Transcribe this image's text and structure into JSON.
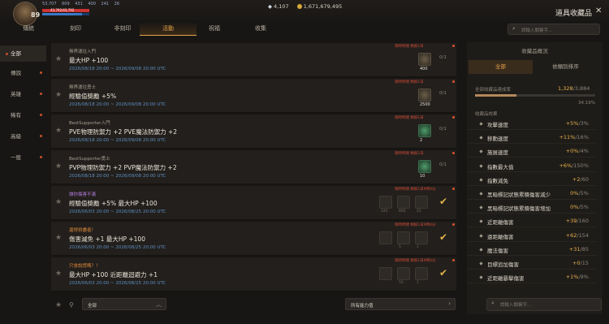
{
  "header": {
    "level": "89",
    "stats": [
      "53,707",
      "609",
      "431",
      "400",
      "241",
      "26"
    ],
    "hp_text": "43,792/43,792",
    "hp_fraction": 1.0,
    "mp_fraction": 0.85,
    "gems": "4,107",
    "gold": "1,671,679,495",
    "title": "道具收藏品",
    "close_icon": "close-icon"
  },
  "tabs": [
    {
      "label": "傳統"
    },
    {
      "label": "刻印"
    },
    {
      "label": "非刻印"
    },
    {
      "label": "活動",
      "active": true
    },
    {
      "label": "祝福"
    },
    {
      "label": "收集"
    }
  ],
  "search": {
    "placeholder": "請輸入關鍵字..."
  },
  "sidebar": [
    {
      "label": "全部",
      "active": true
    },
    {
      "label": "傳說"
    },
    {
      "label": "英雄"
    },
    {
      "label": "稀有"
    },
    {
      "label": "高級"
    },
    {
      "label": "一般"
    }
  ],
  "list": [
    {
      "category": "無界運往入門",
      "cat_color": "normal",
      "name": "最大HP +100",
      "date": "2026/08/18 20:00 ~ 2026/09/08 20:00 UTC",
      "limit": "限時時間 剩餘1日",
      "items": [
        {
          "count": "400",
          "type": "gold"
        }
      ],
      "progress": "0/1"
    },
    {
      "category": "無界運往勇士",
      "cat_color": "normal",
      "name": "經驗值獎勵 +5%",
      "date": "2026/08/18 20:00 ~ 2026/09/08 20:00 UTC",
      "limit": "限時時間 剩餘1日",
      "items": [
        {
          "count": "2500",
          "type": "gold"
        }
      ],
      "progress": "0/1"
    },
    {
      "category": "BestSupporter入門",
      "cat_color": "normal",
      "name": "PVE物理防禦力 +2 PVE魔法防禦力 +2",
      "date": "2026/08/18 20:00 ~ 2026/09/08 20:00 UTC",
      "limit": "限時時間 剩餘1日",
      "items": [
        {
          "count": "2",
          "type": "green"
        }
      ],
      "progress": "0/1"
    },
    {
      "category": "BestSupporter勇士",
      "cat_color": "normal",
      "name": "PVP物理防禦力 +2 PVP魔法防禦力 +2",
      "date": "2026/08/18 20:00 ~ 2026/09/08 20:00 UTC",
      "limit": "限時時間 剩餘1日",
      "items": [
        {
          "count": "10",
          "type": "green"
        }
      ],
      "progress": "0/1"
    },
    {
      "category": "讓你傷害不滿",
      "cat_color": "purple",
      "name": "經驗值獎勵 +5% 最大HP +100",
      "date": "2026/06/03 20:00 ~ 2026/08/25 20:00 UTC",
      "limit": "限時時間 剩餘1日9時0分",
      "items": [
        {
          "count": "340",
          "type": "dim"
        },
        {
          "count": "800",
          "type": "dim"
        },
        {
          "count": "41",
          "type": "dim"
        }
      ],
      "done": true
    },
    {
      "category": "還得拚盡者！",
      "cat_color": "orange",
      "name": "傷害減免 +1 最大HP +100",
      "date": "2026/06/03 20:00 ~ 2026/08/25 20:00 UTC",
      "limit": "限時時間 剩餘1日9時0分",
      "items": [
        {
          "count": "",
          "type": "dim"
        },
        {
          "count": "5",
          "type": "dim"
        },
        {
          "count": "1",
          "type": "dim"
        }
      ],
      "done": true
    },
    {
      "category": "只會說謊嗎？！",
      "cat_color": "orange",
      "name": "最大HP +100 近距離迴避力 +1",
      "date": "2026/06/03 20:00 ~ 2026/08/25 20:00 UTC",
      "limit": "限時時間 剩餘1日9時0分",
      "items": [
        {
          "count": "",
          "type": "dim"
        },
        {
          "count": "50",
          "type": "dim"
        },
        {
          "count": "1",
          "type": "dim"
        }
      ],
      "done": true
    },
    {
      "category": "殺戮執著",
      "cat_color": "orange",
      "name": "",
      "date": "",
      "limit": "",
      "items": [],
      "partial": true
    }
  ],
  "bottom": {
    "filter_value": "全部",
    "stat_filter_value": "所有能力值"
  },
  "right_panel": {
    "header": "收藏品概況",
    "tabs": [
      {
        "label": "全部",
        "active": true
      },
      {
        "label": "依類別排序"
      }
    ],
    "completion_label": "全部收藏品達成率",
    "completion_done": "1,328",
    "completion_total": "3,884",
    "completion_fraction": 0.3419,
    "completion_pct": "34.19%",
    "effects_label": "收藏品效果",
    "stats": [
      {
        "name": "攻擊速度",
        "value": "+5%",
        "max": "/3%"
      },
      {
        "name": "移動速度",
        "value": "+11%",
        "max": "/16%"
      },
      {
        "name": "施展速度",
        "value": "+0%",
        "max": "/4%"
      },
      {
        "name": "指數最大值",
        "value": "+6%",
        "max": "/150%"
      },
      {
        "name": "指數減免",
        "value": "+2",
        "max": "/60"
      },
      {
        "name": "黑暗標記狀態累積傷害減少",
        "value": "0%",
        "max": "/5%"
      },
      {
        "name": "黑暗標記狀態累積傷害增加",
        "value": "0%",
        "max": "/5%"
      },
      {
        "name": "近距離傷害",
        "value": "+39",
        "max": "/160"
      },
      {
        "name": "遠距離傷害",
        "value": "+62",
        "max": "/154"
      },
      {
        "name": "魔法傷害",
        "value": "+31",
        "max": "/85"
      },
      {
        "name": "目標追加傷害",
        "value": "+0",
        "max": "/15"
      },
      {
        "name": "近距離暴擊傷害",
        "value": "+1%",
        "max": "/9%"
      }
    ]
  },
  "colors": {
    "accent": "#e4a24a",
    "date": "#5e8fc2",
    "limit": "#d04a36",
    "alert_dot": "#d9532a"
  }
}
